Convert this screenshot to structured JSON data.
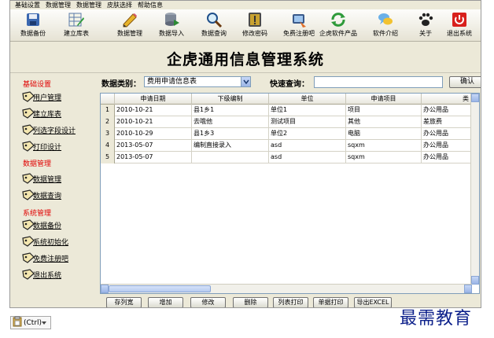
{
  "menu": [
    "基础设置",
    "数据管理",
    "数据管理",
    "皮肤选择",
    "帮助信息"
  ],
  "toolbar": {
    "buttons": [
      {
        "label": "数据备份",
        "icon": "disk-icon"
      },
      {
        "label": "建立库表",
        "icon": "table-edit-icon"
      },
      {
        "label": "数据管理",
        "icon": "pencil-icon"
      },
      {
        "label": "数据导入",
        "icon": "database-import-icon"
      },
      {
        "label": "数据查询",
        "icon": "magnifier-icon"
      },
      {
        "label": "修改密码",
        "icon": "password-icon"
      },
      {
        "label": "免费注册吧",
        "icon": "register-icon"
      },
      {
        "label": "企虎软件产品",
        "icon": "refresh-icon"
      },
      {
        "label": "软件介绍",
        "icon": "chat-icon"
      },
      {
        "label": "关于",
        "icon": "paw-icon"
      },
      {
        "label": "退出系统",
        "icon": "exit-icon"
      }
    ]
  },
  "banner": {
    "title": "企虎通用信息管理系统"
  },
  "nav": {
    "groups": [
      {
        "title": "基础设置",
        "items": [
          "用户管理",
          "建立库表",
          "列选字段设计",
          "打印设计"
        ]
      },
      {
        "title": "数据管理",
        "items": [
          "数据管理",
          "数据查询"
        ]
      },
      {
        "title": "系统管理",
        "items": [
          "数据备份",
          "系统初始化",
          "免费注册吧",
          "退出系统"
        ]
      }
    ]
  },
  "filter": {
    "category_label": "数据类别：",
    "category_value": "费用申请信息表",
    "search_label": "快速查询：",
    "search_value": "",
    "confirm_label": "确认"
  },
  "grid": {
    "columns": [
      "申请日期",
      "下级编制",
      "单位",
      "申请项目",
      "类"
    ],
    "rows": [
      {
        "num": "1",
        "cells": [
          "2010-10-21",
          "县1乡1",
          "单位1",
          "项目",
          "办公用品"
        ]
      },
      {
        "num": "2",
        "cells": [
          "2010-10-21",
          "去哦他",
          "测试项目",
          "其他",
          "差旅费"
        ]
      },
      {
        "num": "3",
        "cells": [
          "2010-10-29",
          "县1乡3",
          "单位2",
          "电脑",
          "办公用品"
        ]
      },
      {
        "num": "4",
        "cells": [
          "2013-05-07",
          "编制直接录入",
          "asd",
          "sqxm",
          "办公用品"
        ]
      },
      {
        "num": "5",
        "cells": [
          "2013-05-07",
          "",
          "asd",
          "sqxm",
          "办公用品"
        ]
      }
    ]
  },
  "actions": [
    "存列宽",
    "增加",
    "修改",
    "删除",
    "列表打印",
    "单据打印",
    "导出EXCEL"
  ],
  "watermark": "最需教育",
  "paste": {
    "label": "(Ctrl)"
  }
}
